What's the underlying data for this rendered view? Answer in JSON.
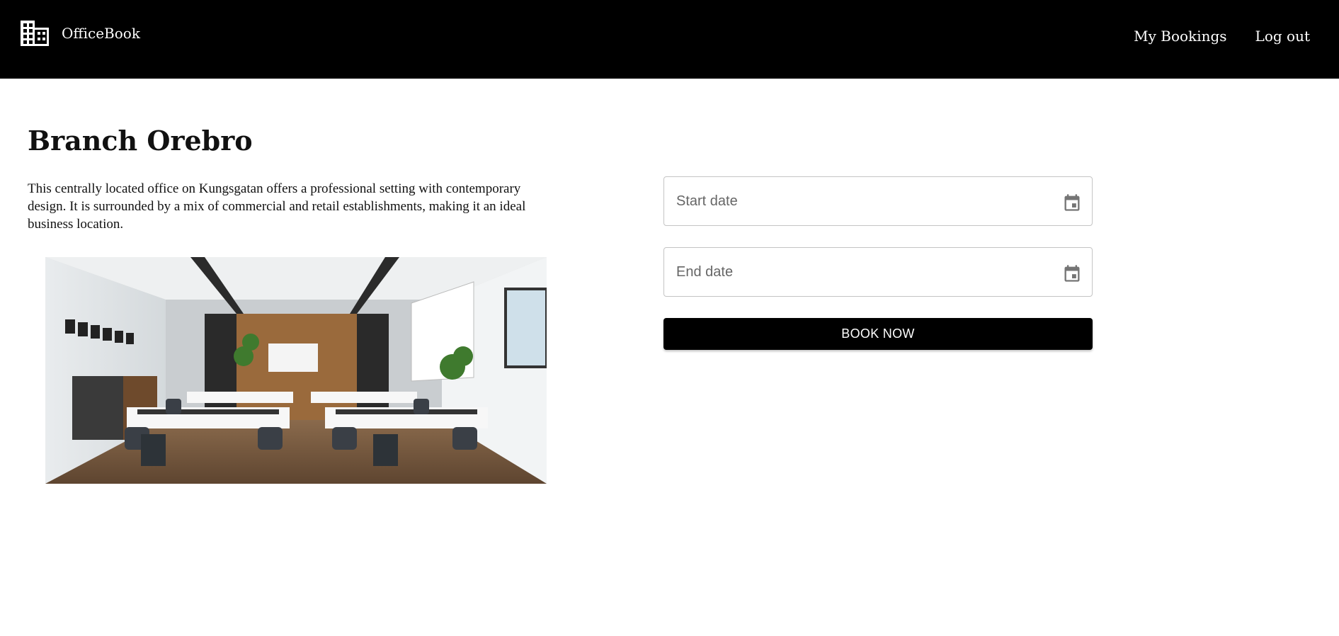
{
  "navbar": {
    "brand_icon": "office-building-icon",
    "brand_name": "OfficeBook",
    "links": [
      {
        "label": "My Bookings"
      },
      {
        "label": "Log out"
      }
    ]
  },
  "branch": {
    "title": "Branch Orebro",
    "description": "This centrally located office on Kungsgatan offers a professional setting with contemporary design. It is surrounded by a mix of commercial and retail establishments, making it an ideal business location.",
    "image_subject": "open-plan office interior with desks, chairs and wooden floor"
  },
  "booking_form": {
    "start_date": {
      "placeholder": "Start date",
      "value": "",
      "icon": "calendar-icon"
    },
    "end_date": {
      "placeholder": "End date",
      "value": "",
      "icon": "calendar-icon"
    },
    "submit_label": "BOOK NOW"
  },
  "colors": {
    "navbar_bg": "#000000",
    "navbar_text": "#ffffff",
    "button_bg": "#000000",
    "button_text": "#ffffff",
    "field_border": "#c4c4c4",
    "icon_gray": "#757575"
  }
}
